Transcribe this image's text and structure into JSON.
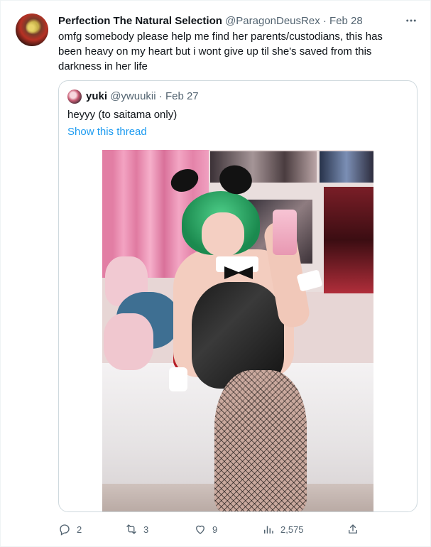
{
  "tweet": {
    "author_name": "Perfection The Natural Selection",
    "handle": "@ParagonDeusRex",
    "separator": "·",
    "date": "Feb 28",
    "text": "omfg somebody please help me find her parents/custodians, this has been heavy on my heart but i wont give up til she's saved from this darkness in her life",
    "more_icon": "more-horizontal-icon"
  },
  "quoted_tweet": {
    "author_name": "yuki",
    "handle": "@ywuukii",
    "separator": "·",
    "date": "Feb 27",
    "text": "heyyy (to saitama only)",
    "show_thread_label": "Show this thread"
  },
  "actions": {
    "reply_count": "2",
    "retweet_count": "3",
    "like_count": "9",
    "views_count": "2,575",
    "icons": [
      "reply-icon",
      "retweet-icon",
      "like-icon",
      "views-icon",
      "share-icon"
    ]
  },
  "colors": {
    "text_primary": "#0f1419",
    "text_secondary": "#536471",
    "link": "#1d9bf0",
    "border": "#cfd9de"
  }
}
